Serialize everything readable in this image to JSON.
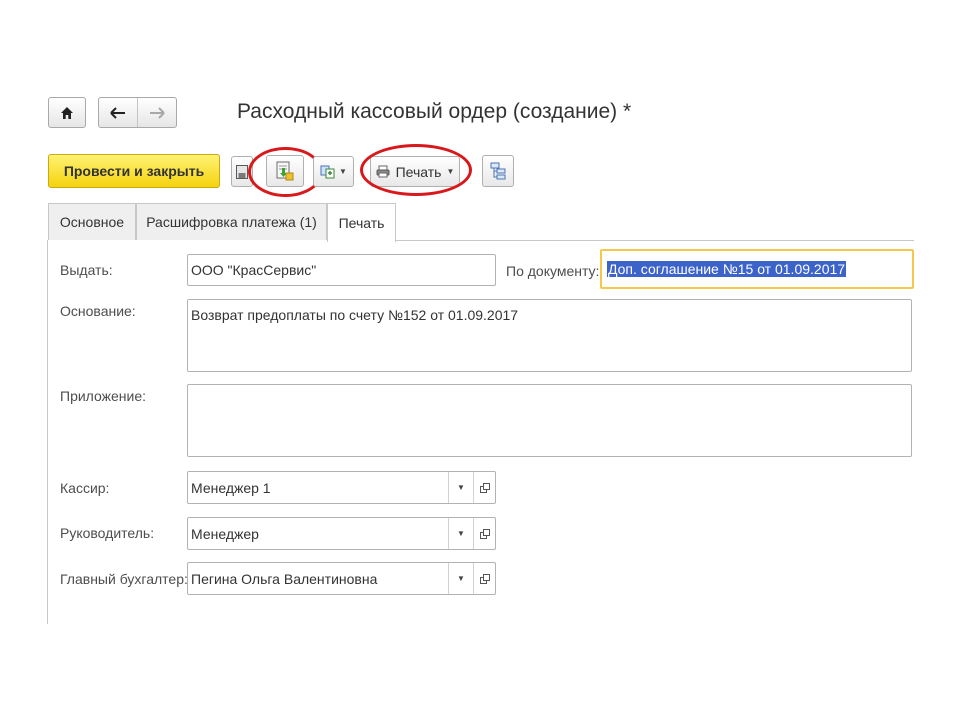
{
  "window": {
    "title": "Расходный кассовый ордер (создание) *"
  },
  "nav": {
    "home": "home-icon",
    "back": "arrow-left-icon",
    "forward": "arrow-right-icon"
  },
  "toolbar": {
    "post_close_label": "Провести и закрыть",
    "print_label": "Печать",
    "accent_color": "#f5d30e",
    "highlight_color": "#d8191c"
  },
  "tabs": [
    {
      "label": "Основное",
      "active": false
    },
    {
      "label": "Расшифровка платежа (1)",
      "active": false
    },
    {
      "label": "Печать",
      "active": true
    }
  ],
  "form": {
    "issue_label": "Выдать:",
    "issue_value": "ООО \"КрасСервис\"",
    "by_document_label": "По документу:",
    "by_document_value": "Доп. соглашение №15 от 01.09.2017",
    "basis_label": "Основание:",
    "basis_value": "Возврат предоплаты по счету №152 от 01.09.2017",
    "attachment_label": "Приложение:",
    "attachment_value": "",
    "cashier_label": "Кассир:",
    "cashier_value": "Менеджер 1",
    "head_label": "Руководитель:",
    "head_value": "Менеджер",
    "accountant_label": "Главный бухгалтер:",
    "accountant_value": "Пегина Ольга Валентиновна"
  }
}
